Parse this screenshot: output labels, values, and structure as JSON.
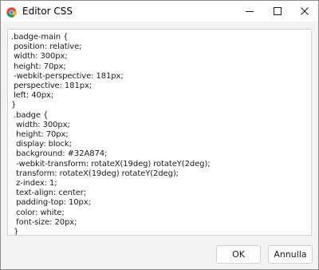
{
  "window": {
    "title": "Editor CSS",
    "app_icon": "chrome-like-app-icon",
    "controls": {
      "minimize_icon": "minimize-icon",
      "maximize_icon": "maximize-icon",
      "close_icon": "close-icon"
    }
  },
  "editor": {
    "lines": [
      ".badge-main {",
      " position: relative;",
      " width: 300px;",
      " height: 70px;",
      " -webkit-perspective: 181px;",
      " perspective: 181px;",
      " left: 40px;",
      "}",
      " .badge {",
      "  width: 300px;",
      "  height: 70px;",
      "  display: block;",
      "  background: #32A874;",
      "  -webkit-transform: rotateX(19deg) rotateY(2deg);",
      "  transform: rotateX(19deg) rotateY(2deg);",
      "  z-index: 1;",
      "  text-align: center;",
      "  padding-top: 10px;",
      "  color: white;",
      "  font-size: 20px;",
      " }"
    ]
  },
  "buttons": {
    "ok_label": "OK",
    "cancel_label": "Annulla"
  },
  "colors": {
    "window_bg": "#f3f3f3",
    "editor_bg": "#ffffff",
    "border": "#d2d2d2"
  }
}
